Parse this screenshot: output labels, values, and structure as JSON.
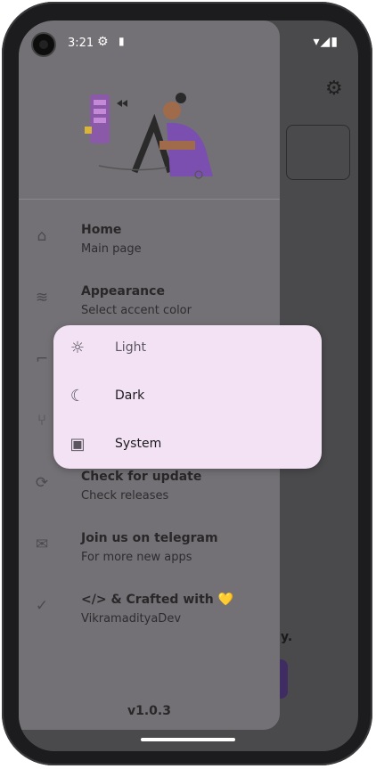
{
  "status_bar": {
    "time": "3:21",
    "left_icons": [
      "settings-icon",
      "sd-card-icon"
    ],
    "right_icons": [
      "wifi-icon",
      "signal-icon",
      "battery-icon"
    ]
  },
  "drawer": {
    "items": [
      {
        "title": "Home",
        "subtitle": "Main page",
        "icon": "home-icon"
      },
      {
        "title": "Appearance",
        "subtitle": "Select accent color",
        "icon": "layers-icon"
      },
      {
        "title": "",
        "subtitle": "",
        "icon": "paint-roller-icon"
      },
      {
        "title": "",
        "subtitle": "",
        "icon": "git-branch-icon"
      },
      {
        "title": "Check for update",
        "subtitle": "Check releases",
        "icon": "sync-icon"
      },
      {
        "title": "Join us on telegram",
        "subtitle": "For more new apps",
        "icon": "send-mail-icon"
      },
      {
        "title": "</> & Crafted with 💛",
        "subtitle": "VikramadityaDev",
        "icon": "verified-badge-icon"
      }
    ],
    "version": "v1.0.3"
  },
  "background": {
    "fragment_text": "y."
  },
  "theme_menu": {
    "options": [
      {
        "label": "Light",
        "icon": "sun-icon"
      },
      {
        "label": "Dark",
        "icon": "moon-icon"
      },
      {
        "label": "System",
        "icon": "chip-icon"
      }
    ]
  }
}
